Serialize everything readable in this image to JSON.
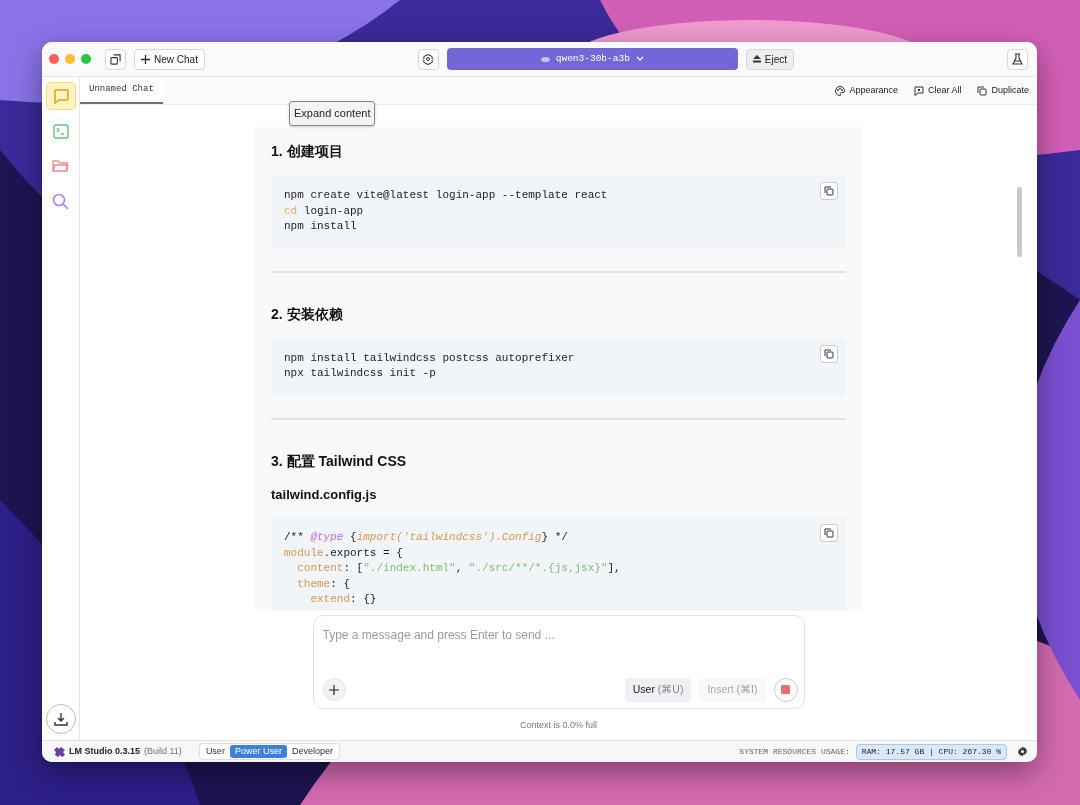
{
  "toolbar": {
    "new_chat": "New Chat",
    "tooltip": "Expand content",
    "model": "qwen3-30b-a3b",
    "eject": "Eject"
  },
  "sidebar": {
    "items": [
      {
        "kind": "chat",
        "selected": true
      },
      {
        "kind": "terminal",
        "selected": false
      },
      {
        "kind": "folder",
        "selected": false
      },
      {
        "kind": "search",
        "selected": false
      }
    ]
  },
  "tabs": [
    {
      "label": "Unnamed Chat",
      "selected": true
    }
  ],
  "tab_actions": [
    {
      "kind": "palette",
      "label": "Appearance"
    },
    {
      "kind": "clear",
      "label": "Clear All"
    },
    {
      "kind": "duplicate",
      "label": "Duplicate"
    }
  ],
  "message": {
    "blocks": [
      {
        "kind": "heading",
        "text": "1. 创建项目"
      },
      {
        "kind": "code",
        "lines": [
          [
            {
              "kind": "plain",
              "text": "npm create vite@latest login-app --template react"
            }
          ],
          [
            {
              "kind": "keyword",
              "text": "cd"
            },
            {
              "kind": "plain",
              "text": " login-app"
            }
          ],
          [
            {
              "kind": "plain",
              "text": "npm install"
            }
          ]
        ]
      },
      {
        "kind": "rule"
      },
      {
        "kind": "heading",
        "text": "2. 安装依赖"
      },
      {
        "kind": "code",
        "lines": [
          [
            {
              "kind": "plain",
              "text": "npm install tailwindcss postcss autoprefixer"
            }
          ],
          [
            {
              "kind": "plain",
              "text": "npx tailwindcss init -p"
            }
          ]
        ]
      },
      {
        "kind": "rule"
      },
      {
        "kind": "heading",
        "text": "3. 配置 Tailwind CSS"
      },
      {
        "kind": "subheading",
        "text": "tailwind.config.js"
      },
      {
        "kind": "code",
        "lines": [
          [
            {
              "kind": "plain",
              "text": "/** "
            },
            {
              "kind": "tag",
              "text": "@type"
            },
            {
              "kind": "plain",
              "text": " {"
            },
            {
              "kind": "type",
              "text": "import('tailwindcss').Config"
            },
            {
              "kind": "plain",
              "text": "} */"
            }
          ],
          [
            {
              "kind": "prop",
              "text": "module"
            },
            {
              "kind": "plain",
              "text": ".exports = {"
            }
          ],
          [
            {
              "kind": "prop",
              "text": "  content"
            },
            {
              "kind": "plain",
              "text": ": ["
            },
            {
              "kind": "string",
              "text": "\"./index.html\""
            },
            {
              "kind": "plain",
              "text": ", "
            },
            {
              "kind": "string",
              "text": "\"./src/**/*.{js,jsx}\""
            },
            {
              "kind": "plain",
              "text": "],"
            }
          ],
          [
            {
              "kind": "prop",
              "text": "  theme"
            },
            {
              "kind": "plain",
              "text": ": {"
            }
          ],
          [
            {
              "kind": "prop",
              "text": "    extend"
            },
            {
              "kind": "plain",
              "text": ": {}"
            }
          ]
        ]
      }
    ]
  },
  "composer": {
    "placeholder": "Type a message and press Enter to send ...",
    "user_button": "User",
    "user_shortcut": "(⌘U)",
    "insert_button": "Insert",
    "insert_shortcut": "(⌘I)",
    "insert_disabled": true
  },
  "context_note": "Context is 0.0% full",
  "status_bar": {
    "app": "LM Studio 0.3.15",
    "build": "(Build 11)",
    "modes": [
      {
        "label": "User",
        "selected": false
      },
      {
        "label": "Power User",
        "selected": true
      },
      {
        "label": "Developer",
        "selected": false
      }
    ],
    "resources_label": "SYSTEM RESOURCES USAGE:",
    "resources": "RAM: 17.57 GB | CPU: 267.30 %"
  }
}
